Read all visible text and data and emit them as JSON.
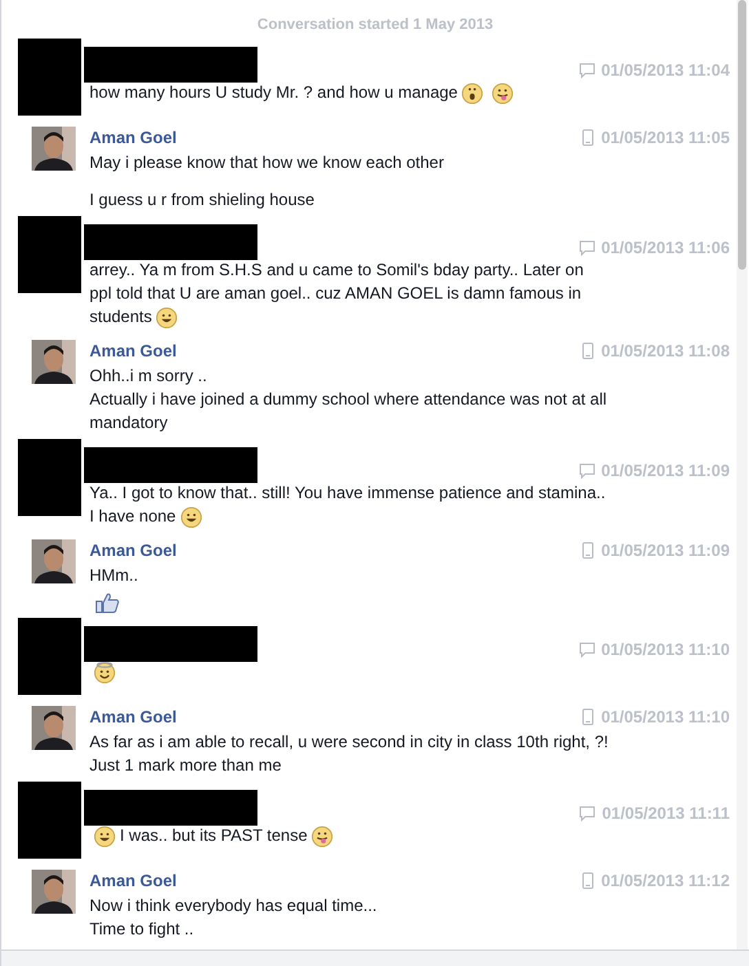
{
  "conversation_start": "Conversation started 1 May 2013",
  "messages": [
    {
      "redacted": true,
      "mobile": false,
      "time": "01/05/2013 11:04",
      "paragraphs": [
        [
          [
            {
              "text": "how many hours U study Mr. ? and how u manage"
            },
            {
              "kind": "gasp"
            },
            {
              "kind": "tongue"
            }
          ]
        ]
      ]
    },
    {
      "redacted": false,
      "name": "Aman Goel",
      "mobile": true,
      "time": "01/05/2013 11:05",
      "paragraphs": [
        [
          [
            {
              "text": "May i please know that how we know each other"
            }
          ]
        ],
        [
          [
            {
              "text": "I guess u r from shieling house"
            }
          ]
        ]
      ]
    },
    {
      "redacted": true,
      "mobile": false,
      "time": "01/05/2013 11:06",
      "paragraphs": [
        [
          [
            {
              "text": "arrey.. Ya m from S.H.S and u came to Somil's bday party.. Later on"
            }
          ],
          [
            {
              "text": "ppl told that U are aman goel.. cuz AMAN GOEL is damn famous in"
            }
          ],
          [
            {
              "text": "students"
            },
            {
              "kind": "smile"
            }
          ]
        ]
      ]
    },
    {
      "redacted": false,
      "name": "Aman Goel",
      "mobile": true,
      "time": "01/05/2013 11:08",
      "paragraphs": [
        [
          [
            {
              "text": "Ohh..i m sorry .."
            }
          ],
          [
            {
              "text": "Actually i have joined a dummy school where attendance was not at all"
            }
          ],
          [
            {
              "text": "mandatory"
            }
          ]
        ]
      ]
    },
    {
      "redacted": true,
      "mobile": false,
      "time": "01/05/2013 11:09",
      "paragraphs": [
        [
          [
            {
              "text": "Ya.. I got to know that.. still! You have immense patience and stamina.."
            }
          ],
          [
            {
              "text": "I have none"
            },
            {
              "kind": "smile"
            }
          ]
        ]
      ]
    },
    {
      "redacted": false,
      "name": "Aman Goel",
      "mobile": true,
      "time": "01/05/2013 11:09",
      "paragraphs": [
        [
          [
            {
              "text": "HMm.."
            }
          ],
          [
            {
              "kind": "like"
            }
          ]
        ]
      ]
    },
    {
      "redacted": true,
      "mobile": false,
      "time": "01/05/2013 11:10",
      "paragraphs": [
        [
          [
            {
              "kind": "halo"
            }
          ]
        ]
      ]
    },
    {
      "redacted": false,
      "name": "Aman Goel",
      "mobile": true,
      "time": "01/05/2013 11:10",
      "paragraphs": [
        [
          [
            {
              "text": "As far as i am able to recall, u were second in city in class 10th right, ?!"
            }
          ],
          [
            {
              "text": "Just 1 mark more than me"
            }
          ]
        ]
      ]
    },
    {
      "redacted": true,
      "mobile": false,
      "time": "01/05/2013 11:11",
      "paragraphs": [
        [
          [
            {
              "kind": "smile"
            },
            {
              "text": "I was.. but its PAST tense"
            },
            {
              "kind": "tongue"
            }
          ]
        ]
      ]
    },
    {
      "redacted": false,
      "name": "Aman Goel",
      "mobile": true,
      "time": "01/05/2013 11:12",
      "paragraphs": [
        [
          [
            {
              "text": "Now i think everybody has equal time..."
            }
          ],
          [
            {
              "text": "Time to fight .."
            }
          ]
        ]
      ]
    }
  ]
}
